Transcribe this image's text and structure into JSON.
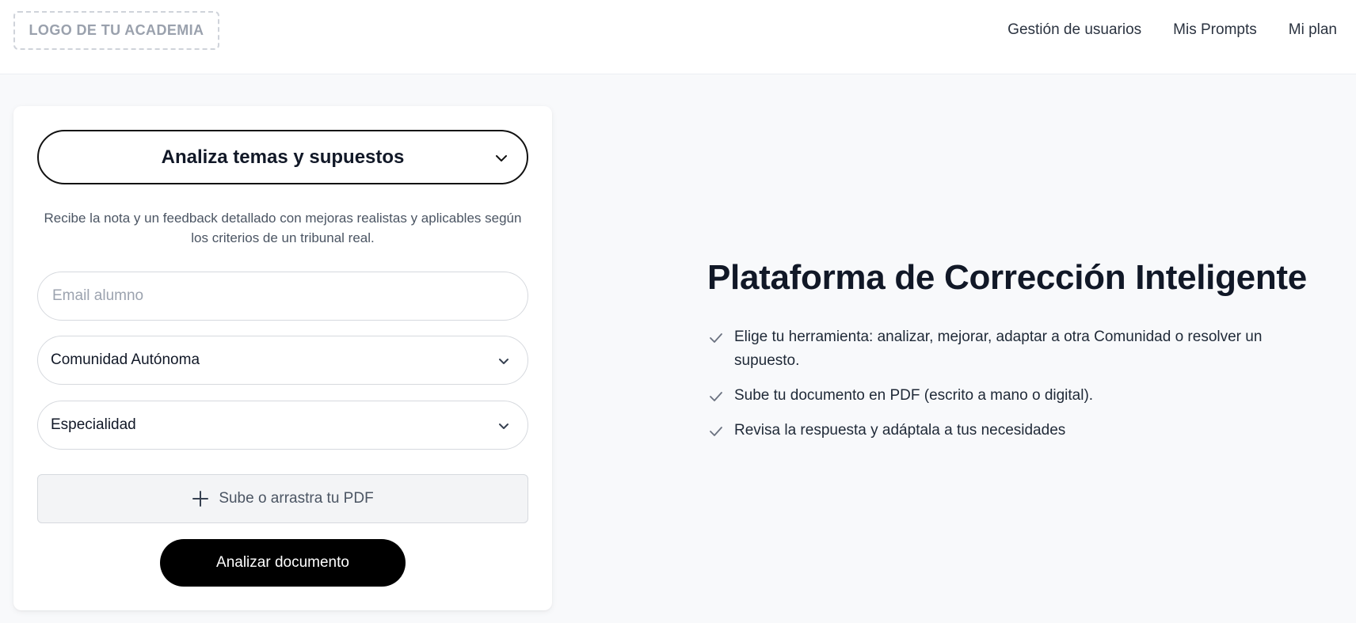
{
  "header": {
    "logo": "LOGO DE TU ACADEMIA",
    "nav": [
      {
        "label": "Gestión de usuarios"
      },
      {
        "label": "Mis Prompts"
      },
      {
        "label": "Mi plan"
      }
    ]
  },
  "form": {
    "tool_select": {
      "value": "Analiza temas y supuestos",
      "icon": "chevron-down-icon"
    },
    "description": "Recibe la nota y un feedback detallado con mejoras realistas y aplicables según los criterios de un tribunal real.",
    "email": {
      "placeholder": "Email alumno",
      "value": ""
    },
    "comunidad": {
      "value": "Comunidad Autónoma",
      "icon": "chevron-down-icon"
    },
    "especialidad": {
      "value": "Especialidad",
      "icon": "chevron-down-icon"
    },
    "upload": {
      "label": "Sube o arrastra tu PDF",
      "icon": "plus-icon"
    },
    "submit": {
      "label": "Analizar documento"
    }
  },
  "hero": {
    "title": "Plataforma de Corrección Inteligente",
    "steps": [
      {
        "text": "Elige tu herramienta: analizar, mejorar, adaptar a otra Comunidad o resolver un supuesto.",
        "icon": "check-icon"
      },
      {
        "text": "Sube tu documento en PDF (escrito a mano o digital).",
        "icon": "check-icon"
      },
      {
        "text": "Revisa la respuesta y adáptala a tus necesidades",
        "icon": "check-icon"
      }
    ]
  },
  "colors": {
    "background": "#f8f9fb",
    "primary_button": "#000000",
    "text": "#111827"
  }
}
